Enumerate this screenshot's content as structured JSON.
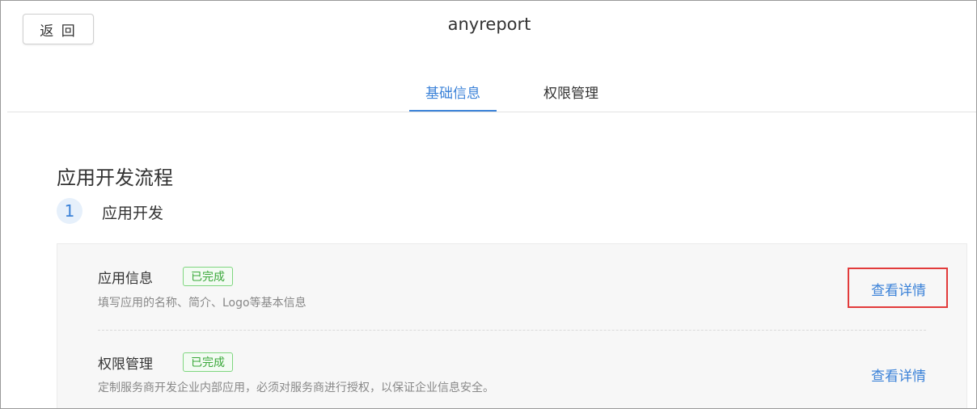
{
  "header": {
    "back_label": "返 回",
    "app_title": "anyreport"
  },
  "tabs": [
    {
      "label": "基础信息",
      "active": true
    },
    {
      "label": "权限管理",
      "active": false
    }
  ],
  "section": {
    "title": "应用开发流程",
    "step_number": "1",
    "step_label": "应用开发"
  },
  "items": [
    {
      "name": "应用信息",
      "status": "已完成",
      "description": "填写应用的名称、简介、Logo等基本信息",
      "link": "查看详情"
    },
    {
      "name": "权限管理",
      "status": "已完成",
      "description": "定制服务商开发企业内部应用，必须对服务商进行授权，以保证企业信息安全。",
      "link": "查看详情"
    }
  ],
  "colors": {
    "accent": "#3b82d8",
    "success": "#3aa83a",
    "highlight": "#e23b3b"
  }
}
